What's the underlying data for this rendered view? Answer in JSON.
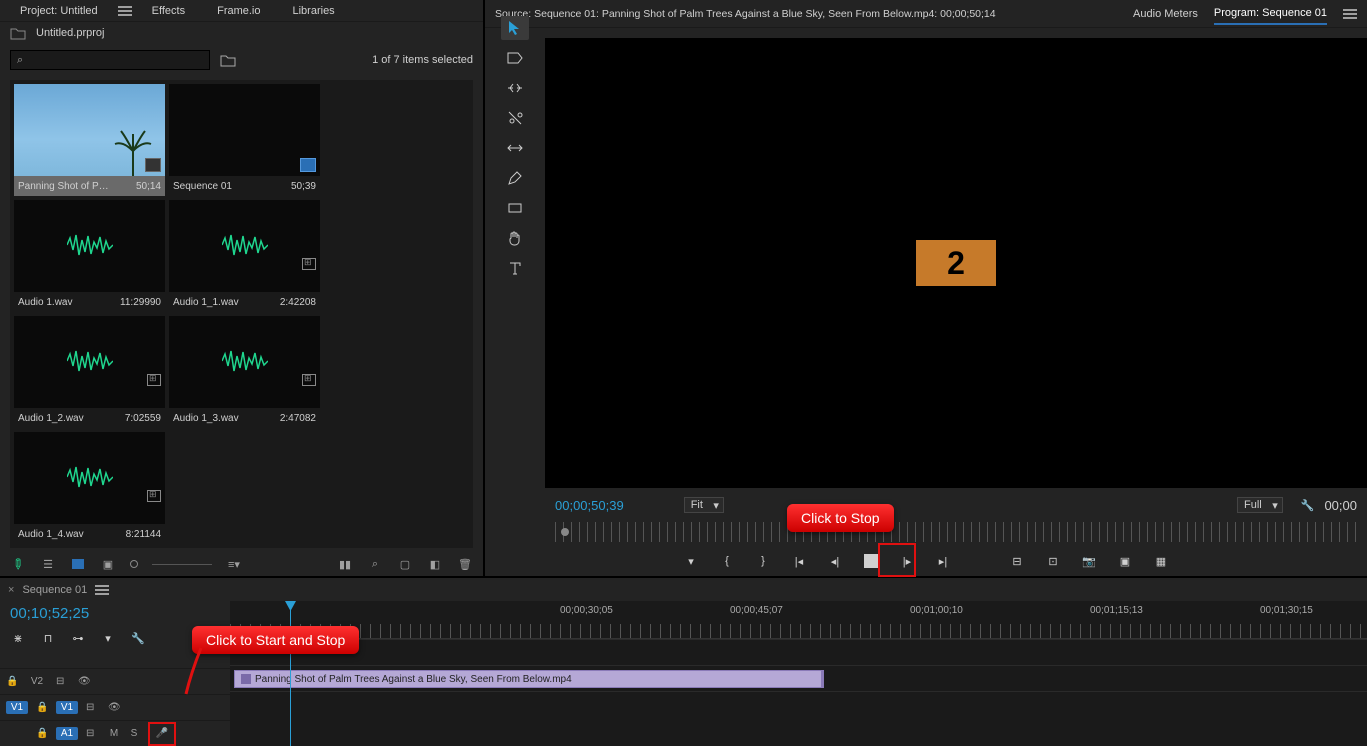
{
  "project_panel": {
    "tabs": [
      "Project: Untitled",
      "Effects",
      "Frame.io",
      "Libraries"
    ],
    "file_name": "Untitled.prproj",
    "items_selected": "1 of 7 items selected",
    "media_items": [
      {
        "name": "Panning Shot of P…",
        "duration": "50;14",
        "type": "video",
        "selected": true
      },
      {
        "name": "Sequence 01",
        "duration": "50;39",
        "type": "sequence"
      },
      {
        "name": "Audio 1.wav",
        "duration": "11:29990",
        "type": "audio"
      },
      {
        "name": "Audio 1_1.wav",
        "duration": "2:42208",
        "type": "audio"
      },
      {
        "name": "Audio 1_2.wav",
        "duration": "7:02559",
        "type": "audio"
      },
      {
        "name": "Audio 1_3.wav",
        "duration": "2:47082",
        "type": "audio"
      },
      {
        "name": "Audio 1_4.wav",
        "duration": "8:21144",
        "type": "audio"
      }
    ]
  },
  "source_panel": {
    "source_tab": "Source: Sequence 01: Panning Shot of Palm Trees Against a Blue Sky, Seen From Below.mp4: 00;00;50;14",
    "audio_meters_tab": "Audio Meters",
    "program_tab": "Program: Sequence 01",
    "countdown": "2",
    "timecode": "00;00;50;39",
    "fit_label": "Fit",
    "full_label": "Full",
    "timecode_right": "00;00"
  },
  "timeline": {
    "sequence_tab": "Sequence 01",
    "timecode": "00;10;52;25",
    "ruler_ticks": [
      "00;00;30;05",
      "00;00;45;07",
      "00;01;00;10",
      "00;01;15;13",
      "00;01;30;15"
    ],
    "tracks": {
      "v2": "V2",
      "v1_src": "V1",
      "v1_tgt": "V1",
      "a1": "A1",
      "m": "M",
      "s": "S"
    },
    "clip_name": "Panning Shot of Palm Trees Against a Blue Sky, Seen From Below.mp4"
  },
  "callouts": {
    "stop": "Click to Stop",
    "start_stop": "Click to Start and Stop"
  },
  "tools": [
    "selection",
    "track-select-forward",
    "ripple-edit",
    "razor",
    "slip",
    "pen",
    "rectangle",
    "hand",
    "type"
  ]
}
